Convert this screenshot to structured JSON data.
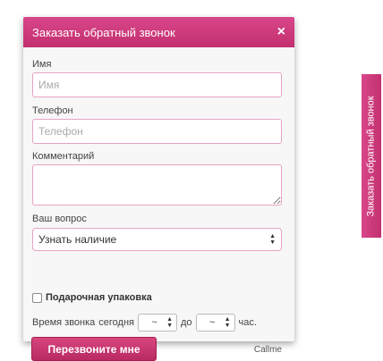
{
  "modal": {
    "title": "Заказать обратный звонок",
    "close": "×",
    "name_label": "Имя",
    "name_placeholder": "Имя",
    "phone_label": "Телефон",
    "phone_placeholder": "Телефон",
    "comment_label": "Комментарий",
    "question_label": "Ваш вопрос",
    "question_value": "Узнать наличие",
    "gift_label": "Подарочная упаковка",
    "time_label": "Время звонка",
    "time_day": "сегодня",
    "time_from": "~",
    "time_to_label": "до",
    "time_to": "~",
    "time_unit": "час.",
    "submit_label": "Перезвоните мне",
    "brand": "Callme"
  },
  "side_tab": {
    "label": "Заказать обратный звонок"
  },
  "colors": {
    "accent": "#c9357a",
    "border": "#e7a3c5"
  }
}
